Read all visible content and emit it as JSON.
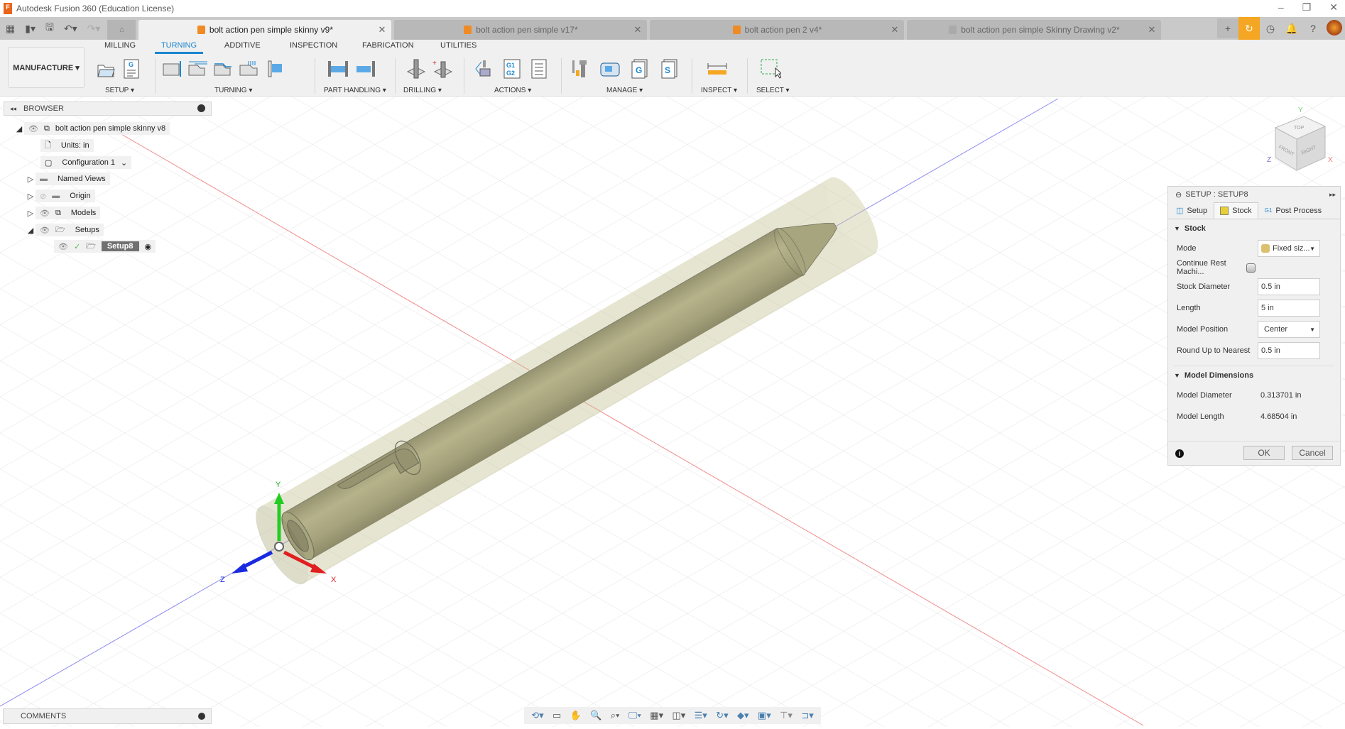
{
  "app": {
    "title": "Autodesk Fusion 360 (Education License)",
    "window_controls": [
      "–",
      "❐",
      "✕"
    ]
  },
  "tabs": [
    {
      "label": "bolt action pen simple skinny v9*",
      "active": true,
      "icon": "cube-icon"
    },
    {
      "label": "bolt action pen simple v17*",
      "active": false,
      "icon": "cube-icon"
    },
    {
      "label": "bolt action pen 2 v4*",
      "active": false,
      "icon": "cube-icon"
    },
    {
      "label": "bolt action pen simple Skinny Drawing v2*",
      "active": false,
      "icon": "drawing-icon"
    }
  ],
  "toolbar": {
    "workspace": "MANUFACTURE ▾",
    "menu_tabs": [
      "MILLING",
      "TURNING",
      "ADDITIVE",
      "INSPECTION",
      "FABRICATION",
      "UTILITIES"
    ],
    "active_tab": "TURNING",
    "groups": [
      "SETUP ▾",
      "TURNING ▾",
      "PART HANDLING ▾",
      "DRILLING ▾",
      "ACTIONS ▾",
      "MANAGE ▾",
      "INSPECT ▾",
      "SELECT ▾"
    ]
  },
  "browser": {
    "title": "BROWSER",
    "root": "bolt action pen simple skinny v8",
    "items": [
      "Units: in",
      "Configuration 1",
      "Named Views",
      "Origin",
      "Models",
      "Setups"
    ],
    "setup": "Setup8"
  },
  "panel": {
    "title": "SETUP : SETUP8",
    "tabs": [
      "Setup",
      "Stock",
      "Post Process"
    ],
    "active_tab": "Stock",
    "stock_section": "Stock",
    "mode_label": "Mode",
    "mode_value": "Fixed siz...",
    "continue_label": "Continue Rest Machi...",
    "continue_checked": false,
    "diameter_label": "Stock Diameter",
    "diameter_value": "0.5 in",
    "length_label": "Length",
    "length_value": "5 in",
    "position_label": "Model Position",
    "position_value": "Center",
    "round_label": "Round Up to Nearest",
    "round_value": "0.5 in",
    "dims_section": "Model Dimensions",
    "model_diameter_label": "Model Diameter",
    "model_diameter_value": "0.313701 in",
    "model_length_label": "Model Length",
    "model_length_value": "4.68504 in",
    "ok": "OK",
    "cancel": "Cancel"
  },
  "viewcube": {
    "top": "TOP",
    "front": "FRONT",
    "right": "RIGHT"
  },
  "axes": {
    "x": "X",
    "y": "Y",
    "z": "Z"
  },
  "comments": {
    "title": "COMMENTS"
  },
  "colors": {
    "accent": "#1a86d0",
    "orange": "#f5a623",
    "stock": "#c9c8a0",
    "part": "#8d8a68"
  }
}
